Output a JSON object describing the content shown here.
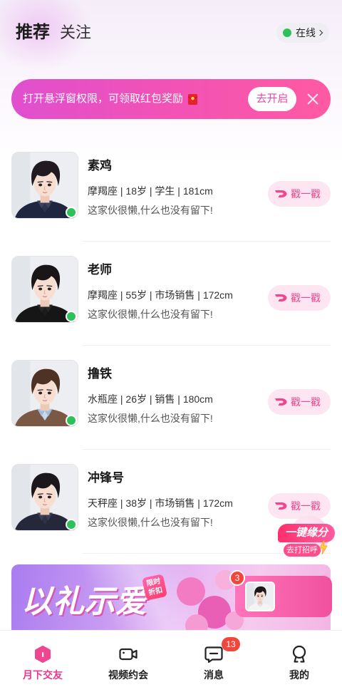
{
  "header": {
    "tab_recommend": "推荐",
    "tab_follow": "关注",
    "online_label": "在线",
    "online_icon": "chevron-right-icon"
  },
  "notice": {
    "text": "打开悬浮窗权限，可领取红包奖励",
    "icon": "red-envelope-icon",
    "button_label": "去开启",
    "close_icon": "close-icon"
  },
  "users": [
    {
      "name": "素鸡",
      "info": "摩羯座 | 18岁 | 学生 | 181cm",
      "bio": "这家伙很懒,什么也没有留下!",
      "online": true,
      "action_label": "戳一戳"
    },
    {
      "name": "老师",
      "info": "摩羯座 | 55岁 | 市场销售 | 172cm",
      "bio": "这家伙很懒,什么也没有留下!",
      "online": true,
      "action_label": "戳一戳"
    },
    {
      "name": "撸铁",
      "info": "水瓶座 | 26岁 | 销售 | 180cm",
      "bio": "这家伙很懒,什么也没有留下!",
      "online": true,
      "action_label": "戳一戳"
    },
    {
      "name": "冲锋号",
      "info": "天秤座 | 38岁 | 市场销售 | 172cm",
      "bio": "这家伙很懒,什么也没有留下!",
      "online": true,
      "action_label": "戳一戳"
    }
  ],
  "quick_match": {
    "title": "一键缘分",
    "action": "去打招呼",
    "icon": "lightning-icon"
  },
  "promo": {
    "title": "以礼示爱",
    "tag_line1": "限时",
    "tag_line2": "折扣"
  },
  "floating_chat": {
    "unread": "3"
  },
  "tabbar": {
    "items": [
      {
        "label": "月下交友",
        "icon": "home-hexagon-icon",
        "active": true
      },
      {
        "label": "视频约会",
        "icon": "video-camera-icon",
        "active": false
      },
      {
        "label": "消息",
        "icon": "message-icon",
        "active": false,
        "badge": "13"
      },
      {
        "label": "我的",
        "icon": "profile-icon",
        "active": false
      }
    ]
  },
  "colors": {
    "accent": "#f0458f",
    "online": "#2ec15a",
    "badge": "#f1463c",
    "notice_start": "#e04fcf",
    "notice_end": "#ff5aa2"
  }
}
